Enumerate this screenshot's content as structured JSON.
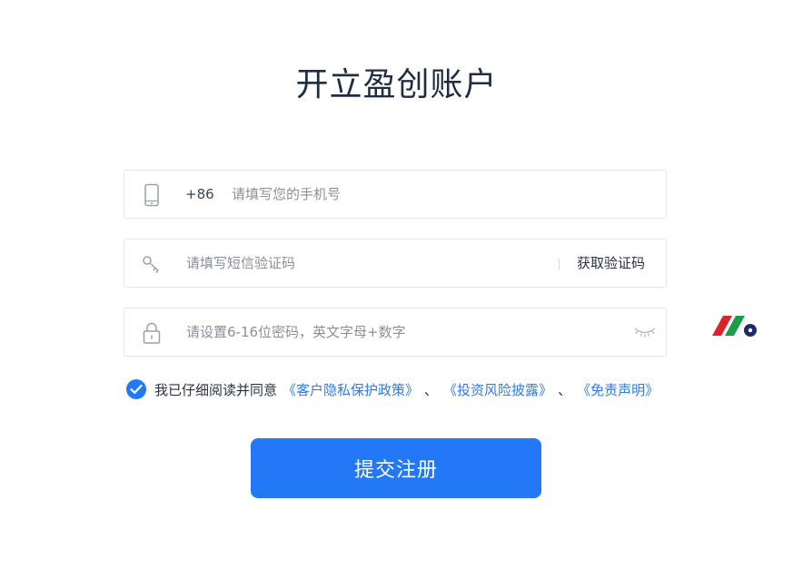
{
  "page": {
    "title": "开立盈创账户"
  },
  "phone": {
    "country_code": "+86",
    "placeholder": "请填写您的手机号",
    "value": ""
  },
  "sms_code": {
    "placeholder": "请填写短信验证码",
    "value": "",
    "get_code_label": "获取验证码"
  },
  "password": {
    "placeholder": "请设置6-16位密码，英文字母+数字",
    "value": ""
  },
  "agreement": {
    "checked": true,
    "prefix_text": "我已仔细阅读并同意",
    "links": [
      {
        "label": "《客户隐私保护政策》"
      },
      {
        "label": "《投资风险披露》"
      },
      {
        "label": "《免责声明》"
      }
    ],
    "separator": "、"
  },
  "submit": {
    "label": "提交注册"
  },
  "colors": {
    "primary": "#2278f6",
    "link": "#2b7ce9",
    "title": "#1f2d44",
    "border": "#e3e6eb"
  },
  "icons": {
    "phone_field": "mobile-phone-icon",
    "code_field": "key-icon",
    "password_field": "lock-icon",
    "password_toggle": "eye-closed-icon",
    "agreement_check": "check-circle-icon",
    "brand": "brand-logo-icon"
  }
}
